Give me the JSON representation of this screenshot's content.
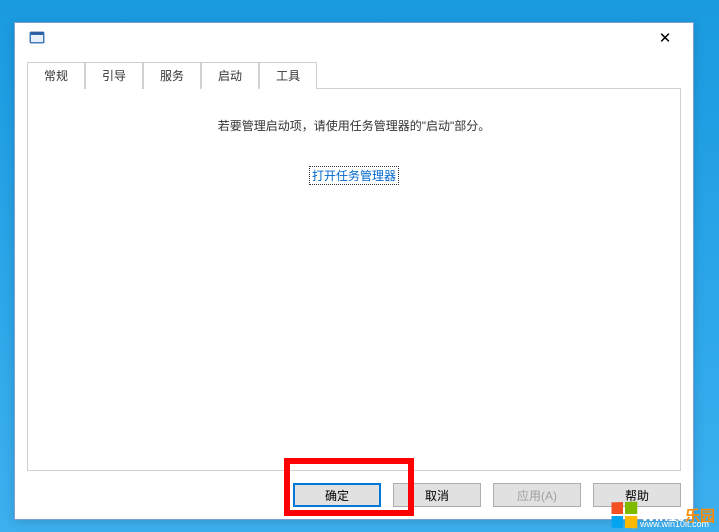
{
  "window": {
    "close_symbol": "✕"
  },
  "tabs": [
    {
      "label": "常规",
      "active": false
    },
    {
      "label": "引导",
      "active": false
    },
    {
      "label": "服务",
      "active": false
    },
    {
      "label": "启动",
      "active": true
    },
    {
      "label": "工具",
      "active": false
    }
  ],
  "content": {
    "instruction": "若要管理启动项，请使用任务管理器的\"启动\"部分。",
    "link_text": "打开任务管理器"
  },
  "buttons": {
    "ok": "确定",
    "cancel": "取消",
    "apply": "应用(A)",
    "help": "帮助"
  },
  "watermark": {
    "brand_prefix": "Win10",
    "brand_suffix": "乐园",
    "url": "www.win10it.com"
  }
}
